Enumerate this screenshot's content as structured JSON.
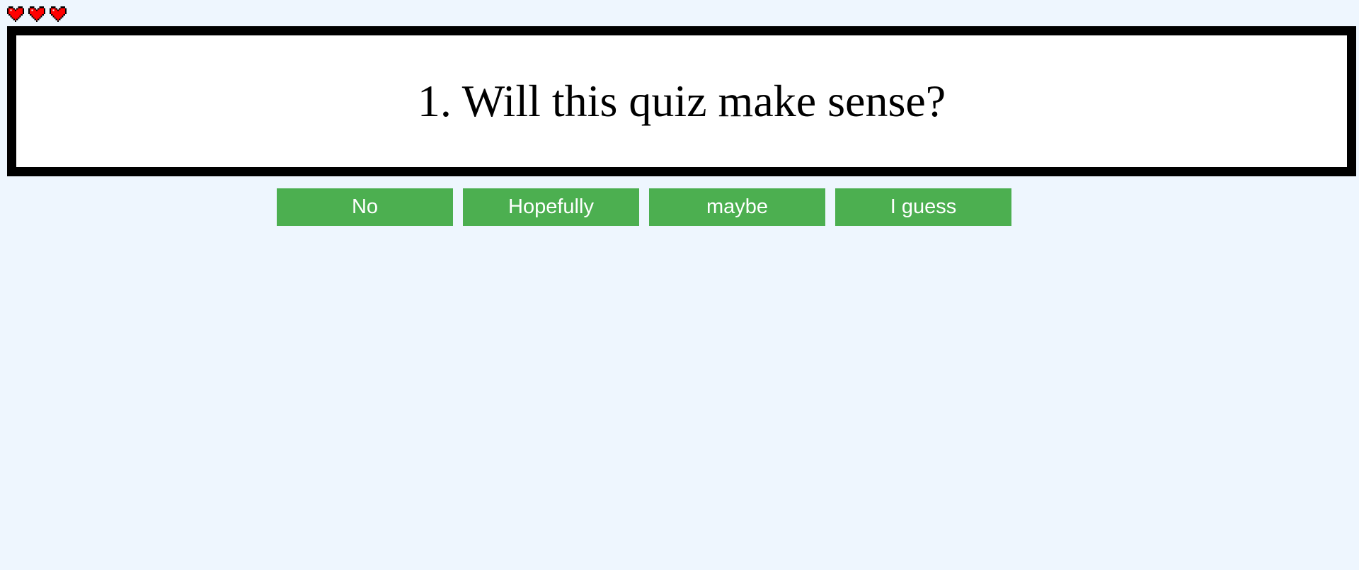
{
  "hud": {
    "lives": 3,
    "heart_icon": "heart-icon",
    "heart_color": "#ff0000"
  },
  "question": {
    "text": "1. Will this quiz make sense?"
  },
  "answers": [
    {
      "label": "No"
    },
    {
      "label": "Hopefully"
    },
    {
      "label": "maybe"
    },
    {
      "label": "I guess"
    }
  ],
  "colors": {
    "background": "#eef6fe",
    "answer_button": "#4caf50",
    "question_border": "#000000"
  }
}
